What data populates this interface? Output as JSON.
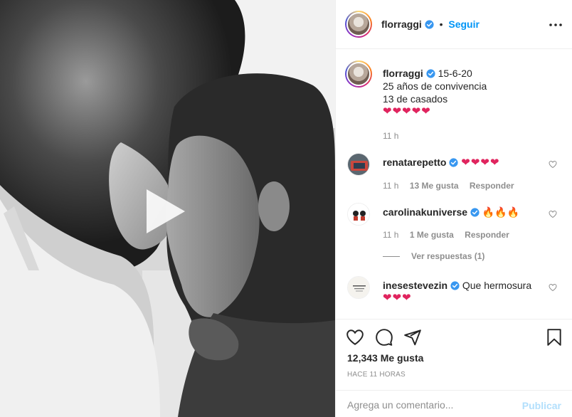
{
  "post": {
    "media_description_icon": "play-icon",
    "author": {
      "username": "florraggi",
      "verified": true,
      "follow_label": "Seguir",
      "separator": "•"
    }
  },
  "caption": {
    "username": "florraggi",
    "text_first": "15-6-20",
    "lines": "25 años de convivencia\n13 de casados",
    "hearts": "❤❤❤❤❤",
    "time": "11 h"
  },
  "comments": [
    {
      "username": "renatarepetto",
      "text": "❤❤❤❤",
      "time": "11 h",
      "likes": "13 Me gusta",
      "reply_label": "Responder"
    },
    {
      "username": "carolinakuniverse",
      "text": "🔥🔥🔥",
      "time": "11 h",
      "likes": "1 Me gusta",
      "reply_label": "Responder",
      "view_replies": "Ver respuestas (1)"
    },
    {
      "username": "inesestevezin",
      "text": "Que hermosura",
      "hearts": "❤❤❤"
    }
  ],
  "stats": {
    "likes": "12,343 Me gusta",
    "posted_ago": "HACE 11 HORAS"
  },
  "add_comment": {
    "placeholder": "Agrega un comentario...",
    "publish_label": "Publicar"
  },
  "colors": {
    "accent": "#0095f6",
    "publish_disabled": "#b2dffc",
    "heart": "#e0245e",
    "muted": "#8e8e8e",
    "text": "#262626"
  }
}
